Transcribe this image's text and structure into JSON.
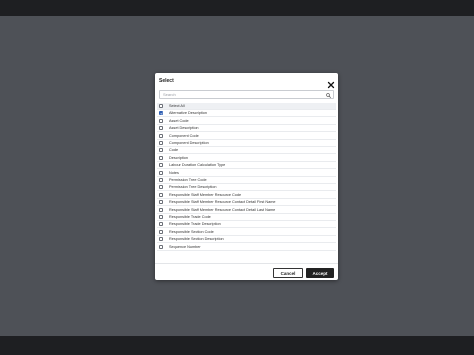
{
  "dialog": {
    "title": "Select",
    "search_placeholder": "Search",
    "items": [
      {
        "label": "Select All",
        "checked": false
      },
      {
        "label": "Alternative Description",
        "checked": true
      },
      {
        "label": "Asset Code",
        "checked": false
      },
      {
        "label": "Asset Description",
        "checked": false
      },
      {
        "label": "Component Code",
        "checked": false
      },
      {
        "label": "Component Description",
        "checked": false
      },
      {
        "label": "Code",
        "checked": false
      },
      {
        "label": "Description",
        "checked": false
      },
      {
        "label": "Labour Duration Calculation Type",
        "checked": false
      },
      {
        "label": "Notes",
        "checked": false
      },
      {
        "label": "Permission Tree Code",
        "checked": false
      },
      {
        "label": "Permission Tree Description",
        "checked": false
      },
      {
        "label": "Responsible Staff Member Resource Code",
        "checked": false
      },
      {
        "label": "Responsible Staff Member Resource Contact Detail First Name",
        "checked": false
      },
      {
        "label": "Responsible Staff Member Resource Contact Detail Last Name",
        "checked": false
      },
      {
        "label": "Responsible Trade Code",
        "checked": false
      },
      {
        "label": "Responsible Trade Description",
        "checked": false
      },
      {
        "label": "Responsible Section Code",
        "checked": false
      },
      {
        "label": "Responsible Section Description",
        "checked": false
      },
      {
        "label": "Sequence Number",
        "checked": false
      }
    ],
    "cancel_label": "Cancel",
    "accept_label": "Accept",
    "accent_color": "#2f5fb3"
  }
}
